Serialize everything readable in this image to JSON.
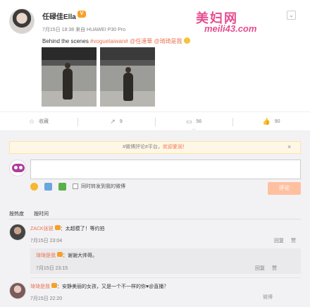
{
  "post": {
    "author": "任碌佳Ella",
    "meta": "7月15日 18:38 来自 HUAWEI P30 Pro",
    "caption_text": "Behind the scenes ",
    "caption_tag": "#voguetaiwan#",
    "caption_mention1": " @任達華",
    "caption_mention2": " @琦琦是我"
  },
  "watermark": {
    "top": "美妇网",
    "url": "meili43.com"
  },
  "actions": [
    {
      "icon": "star-icon",
      "glyph": "☆",
      "label": "收藏"
    },
    {
      "icon": "share-icon",
      "glyph": "↗",
      "label": "9"
    },
    {
      "icon": "comment-icon",
      "glyph": "▭",
      "label": "56"
    },
    {
      "icon": "like-icon",
      "glyph": "👍",
      "label": "90"
    }
  ],
  "notice": {
    "text": "#微博評论#平台，",
    "link": "欢迎爱润！",
    "close": "×"
  },
  "compose": {
    "repost_label": "同时转发到我的微博",
    "submit": "评论"
  },
  "sort": {
    "hot": "按热度",
    "time": "按时间"
  },
  "comments": [
    {
      "name": "ZACK张锐",
      "text": "：太超模了！等约拍",
      "time": "7月15日 23:04",
      "ops": [
        "回复",
        "赞"
      ]
    },
    {
      "name": "琦琦是我",
      "text": "：谢谢大帅哥。",
      "time": "7月15日 23:15",
      "ops": [
        "回复",
        "赞"
      ]
    },
    {
      "name": "琦琦是我",
      "text": "：安静美丽的女孩，又是一个不一样的你♥@直播？",
      "time": "7月15日 22:20",
      "ops": [
        "微博"
      ]
    }
  ],
  "colors": {
    "accent": "#eb7350",
    "watermark": "#e64d8f",
    "submit": "#ffc09f"
  }
}
